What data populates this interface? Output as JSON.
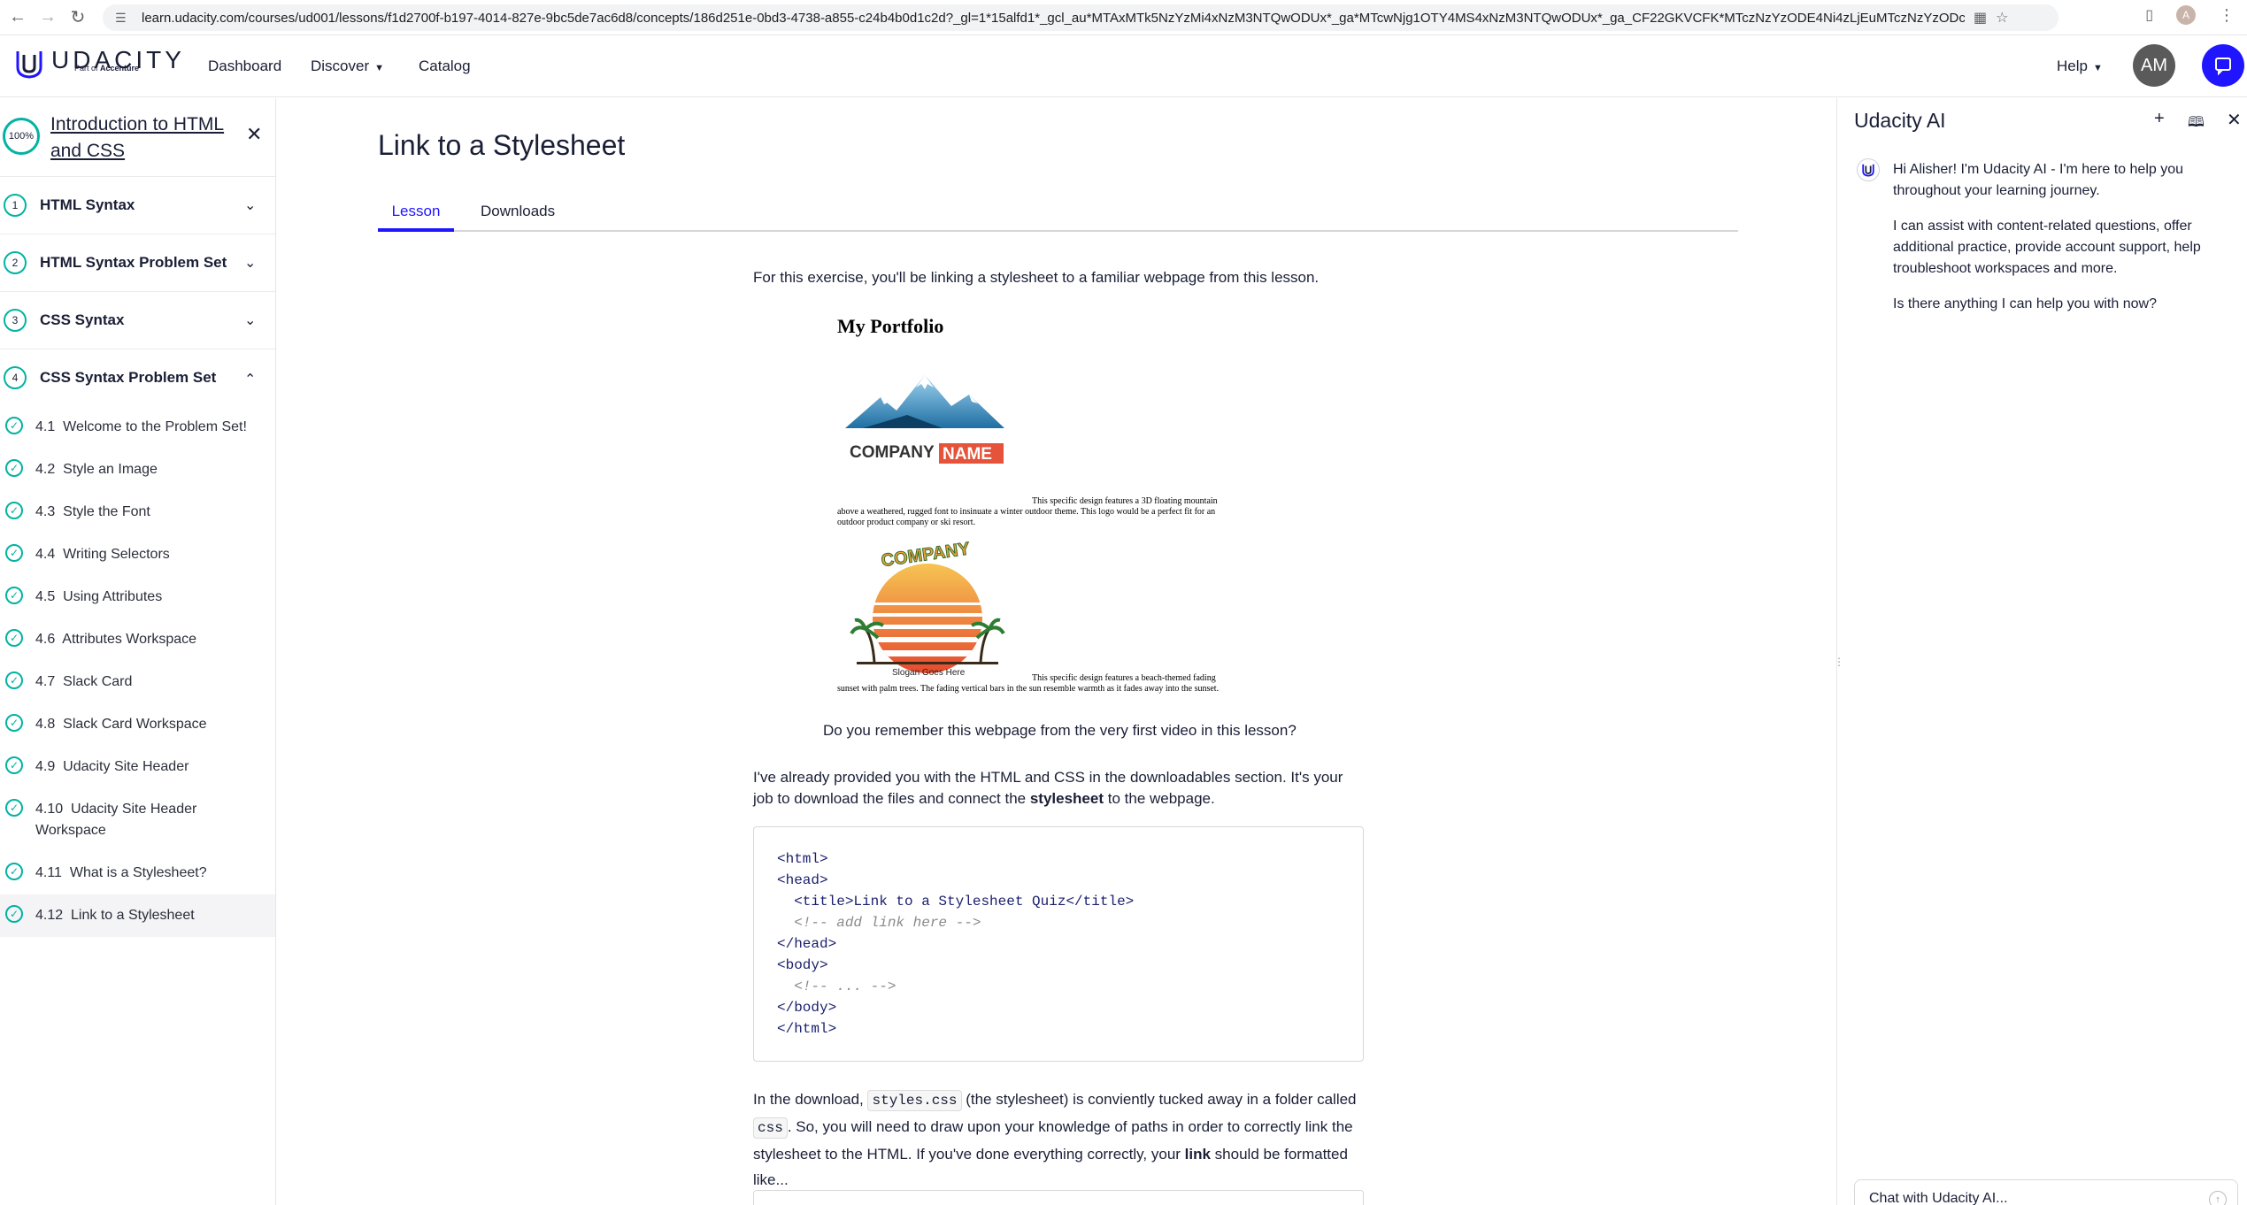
{
  "browser": {
    "url": "learn.udacity.com/courses/ud001/lessons/f1d2700f-b197-4014-827e-9bc5de7ac6d8/concepts/186d251e-0bd3-4738-a855-c24b4b0d1c2d?_gl=1*15alfd1*_gcl_au*MTAxMTk5NzYzMi4xNzM3NTQwODUx*_ga*MTcwNjg1OTY4MS4xNzM3NTQwODUx*_ga_CF22GKVCFK*MTczNzYzODE4Ni4zLjEuMTczNzYzODc3OC42MC4wLjA.",
    "profile_initial": "A"
  },
  "nav": {
    "logo_text": "UDACITY",
    "logo_sub_prefix": "Part of ",
    "logo_sub_brand": "Accenture",
    "dashboard": "Dashboard",
    "discover": "Discover",
    "catalog": "Catalog",
    "help": "Help",
    "avatar_initials": "AM"
  },
  "sidebar": {
    "progress": "100%",
    "course_title": "Introduction to HTML and CSS",
    "lessons": [
      {
        "num": "1",
        "label": "HTML Syntax"
      },
      {
        "num": "2",
        "label": "HTML Syntax Problem Set"
      },
      {
        "num": "3",
        "label": "CSS Syntax"
      },
      {
        "num": "4",
        "label": "CSS Syntax Problem Set"
      }
    ],
    "concepts": [
      {
        "num": "4.1",
        "label": "Welcome to the Problem Set!"
      },
      {
        "num": "4.2",
        "label": "Style an Image"
      },
      {
        "num": "4.3",
        "label": "Style the Font"
      },
      {
        "num": "4.4",
        "label": "Writing Selectors"
      },
      {
        "num": "4.5",
        "label": "Using Attributes"
      },
      {
        "num": "4.6",
        "label": "Attributes Workspace"
      },
      {
        "num": "4.7",
        "label": "Slack Card"
      },
      {
        "num": "4.8",
        "label": "Slack Card Workspace"
      },
      {
        "num": "4.9",
        "label": "Udacity Site Header"
      },
      {
        "num": "4.10",
        "label": "Udacity Site Header Workspace"
      },
      {
        "num": "4.11",
        "label": "What is a Stylesheet?"
      },
      {
        "num": "4.12",
        "label": "Link to a Stylesheet"
      }
    ]
  },
  "main": {
    "title": "Link to a Stylesheet",
    "tabs": {
      "lesson": "Lesson",
      "downloads": "Downloads"
    },
    "intro": "For this exercise, you'll be linking a stylesheet to a familiar webpage from this lesson.",
    "portfolio": {
      "title": "My Portfolio",
      "logo1_word1": "COMPANY",
      "logo1_word2": "NAME",
      "desc1": "This specific design features a 3D floating mountain above a weathered, rugged font to insinuate a winter outdoor theme. This logo would be a perfect fit for an outdoor product company or ski resort.",
      "logo2_word": "COMPANY",
      "logo2_slogan": "Slogan Goes Here",
      "desc2": "This specific design features a beach-themed fading sunset with palm trees. The fading vertical bars in the sun resemble warmth as it fades away into the sunset."
    },
    "caption": "Do you remember this webpage from the very first video in this lesson?",
    "para2_a": "I've already provided you with the HTML and CSS in the downloadables section. It's your job to download the files and connect the ",
    "para2_bold": "stylesheet",
    "para2_b": " to the webpage.",
    "code_lines": [
      {
        "text": "<html>",
        "comment": false
      },
      {
        "text": "<head>",
        "comment": false
      },
      {
        "text": "  <title>Link to a Stylesheet Quiz</title>",
        "comment": false
      },
      {
        "text": "  <!-- add link here -->",
        "comment": true
      },
      {
        "text": "</head>",
        "comment": false
      },
      {
        "text": "<body>",
        "comment": false
      },
      {
        "text": "  <!-- ... -->",
        "comment": true
      },
      {
        "text": "</body>",
        "comment": false
      },
      {
        "text": "</html>",
        "comment": false
      }
    ],
    "para3_a": "In the download, ",
    "para3_code1": "styles.css",
    "para3_b": " (the stylesheet) is conviently tucked away in a folder called ",
    "para3_code2": "css",
    "para3_c": ". So, you will need to draw upon your knowledge of paths in order to correctly link the stylesheet to the HTML. If you've done everything correctly, your ",
    "para3_bold": "link",
    "para3_d": " should be formatted like..."
  },
  "ai": {
    "title": "Udacity AI",
    "msg1": "Hi Alisher! I'm Udacity AI - I'm here to help you throughout your learning journey.",
    "msg2": "I can assist with content-related questions, offer additional practice, provide account support, help troubleshoot workspaces and more.",
    "msg3": "Is there anything I can help you with now?",
    "input_placeholder": "Chat with Udacity AI..."
  },
  "colors": {
    "accent": "#2015ff",
    "teal": "#02b3a3"
  }
}
